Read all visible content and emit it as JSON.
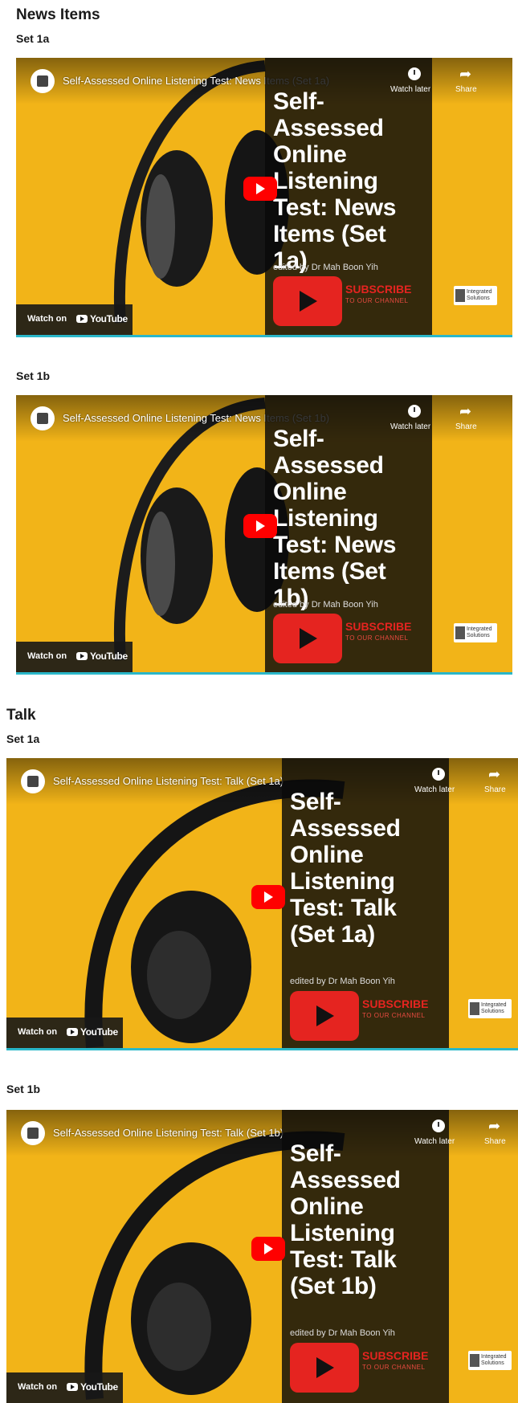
{
  "sections": [
    {
      "heading": "News Items",
      "sets": [
        {
          "label": "Set 1a",
          "video_title": "Self-Assessed Online Listening Test: News Items (Set 1a)",
          "card_title": "Self-\nAssessed\nOnline\nListening\nTest: News\nItems (Set\n1a)"
        },
        {
          "label": "Set 1b",
          "video_title": "Self-Assessed Online Listening Test: News Items (Set 1b)",
          "card_title": "Self-\nAssessed\nOnline\nListening\nTest: News\nItems (Set\n1b)"
        }
      ]
    },
    {
      "heading": "Talk",
      "sets": [
        {
          "label": "Set 1a",
          "video_title": "Self-Assessed Online Listening Test: Talk (Set 1a)",
          "card_title": "Self-\nAssessed\nOnline\nListening\nTest: Talk\n(Set 1a)"
        },
        {
          "label": "Set 1b",
          "video_title": "Self-Assessed Online Listening Test: Talk (Set 1b)",
          "card_title": "Self-\nAssessed\nOnline\nListening\nTest: Talk\n(Set 1b)"
        }
      ]
    }
  ],
  "player": {
    "credit": "edited by Dr Mah Boon Yih",
    "subscribe": "SUBSCRIBE",
    "subscribe_sub": "TO OUR CHANNEL",
    "logo_text": "Integrated Solutions",
    "watch_later": "Watch later",
    "share": "Share",
    "watch_on": "Watch on",
    "youtube": "YouTube"
  },
  "colors": {
    "background": "#f2b418",
    "card": "#111111",
    "accent_red": "#e52420",
    "underline": "#2ab7c9"
  },
  "icons": [
    "channel-icon",
    "clock-icon",
    "share-arrow-icon",
    "play-icon",
    "youtube-logo-icon"
  ]
}
